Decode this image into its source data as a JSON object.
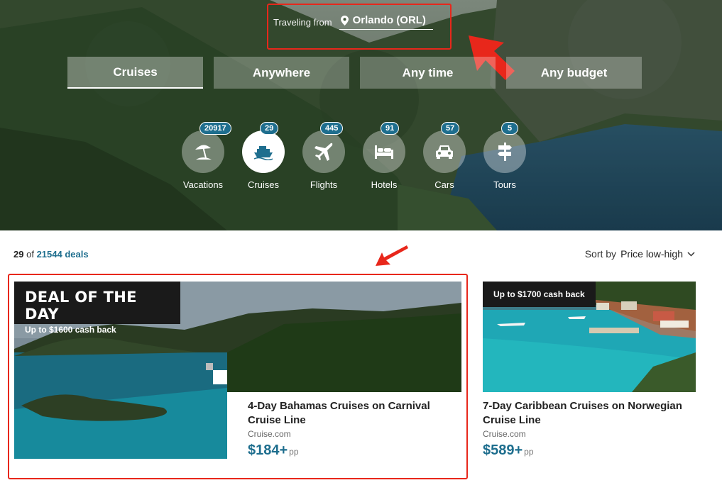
{
  "origin": {
    "label": "Traveling from",
    "value": "Orlando (ORL)",
    "icon": "map-pin-icon"
  },
  "filters": [
    {
      "label": "Cruises",
      "active": true
    },
    {
      "label": "Anywhere",
      "active": false
    },
    {
      "label": "Any time",
      "active": false
    },
    {
      "label": "Any budget",
      "active": false
    }
  ],
  "categories": [
    {
      "name": "Vacations",
      "count": "20917",
      "icon": "beach-umbrella-icon"
    },
    {
      "name": "Cruises",
      "count": "29",
      "icon": "ship-icon"
    },
    {
      "name": "Flights",
      "count": "445",
      "icon": "airplane-icon"
    },
    {
      "name": "Hotels",
      "count": "91",
      "icon": "bed-icon"
    },
    {
      "name": "Cars",
      "count": "57",
      "icon": "car-icon"
    },
    {
      "name": "Tours",
      "count": "5",
      "icon": "signpost-icon"
    }
  ],
  "results": {
    "shown": "29",
    "of_label": "of",
    "total": "21544 deals"
  },
  "sort": {
    "label": "Sort by",
    "value": "Price low-high"
  },
  "deals": [
    {
      "banner_title": "DEAL OF THE DAY",
      "cash_back": "Up to $1600 cash back",
      "title": "4-Day Bahamas Cruises on Carnival Cruise Line",
      "provider": "Cruise.com",
      "price": "$184+",
      "unit": "pp"
    },
    {
      "cash_back": "Up to $1700 cash back",
      "title": "7-Day Caribbean Cruises on Norwegian Cruise Line",
      "provider": "Cruise.com",
      "price": "$589+",
      "unit": "pp"
    }
  ],
  "colors": {
    "accent": "#1e6e8e",
    "highlight": "#e8271b",
    "banner": "#1a1a1a"
  }
}
